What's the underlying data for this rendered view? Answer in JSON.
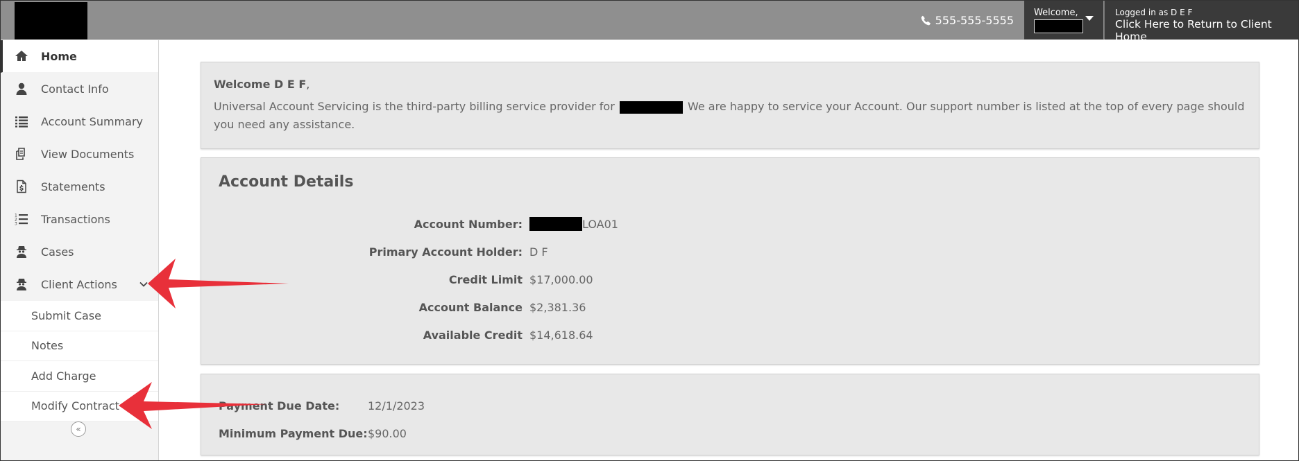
{
  "topbar": {
    "phone": "555-555-5555",
    "welcome_label": "Welcome,",
    "logged_in": "Logged in as D E F",
    "return_link": "Click Here to Return to Client Home"
  },
  "sidebar": {
    "items": [
      {
        "label": "Home",
        "icon": "home-icon"
      },
      {
        "label": "Contact Info",
        "icon": "user-icon"
      },
      {
        "label": "Account Summary",
        "icon": "list-icon"
      },
      {
        "label": "View Documents",
        "icon": "documents-icon"
      },
      {
        "label": "Statements",
        "icon": "statement-icon"
      },
      {
        "label": "Transactions",
        "icon": "ordered-list-icon"
      },
      {
        "label": "Cases",
        "icon": "agent-icon"
      },
      {
        "label": "Client Actions",
        "icon": "agent-icon"
      }
    ],
    "sub_items": [
      "Submit Case",
      "Notes",
      "Add Charge",
      "Modify Contract"
    ],
    "collapse_glyph": "«"
  },
  "welcome": {
    "greeting": "Welcome D E F",
    "comma": ",",
    "msg_before": "Universal Account Servicing is the third-party billing service provider for",
    "msg_after": "We are happy to service your Account. Our support number is listed at the top of every page should you need any assistance."
  },
  "details": {
    "title": "Account Details",
    "account_number_label": "Account Number:",
    "account_number_suffix": "LOA01",
    "holder_label": "Primary Account Holder:",
    "holder_value": "D F",
    "credit_limit_label": "Credit Limit",
    "credit_limit_value": "$17,000.00",
    "balance_label": "Account Balance",
    "balance_value": "$2,381.36",
    "available_label": "Available Credit",
    "available_value": "$14,618.64"
  },
  "payment": {
    "due_date_label": "Payment Due Date:",
    "due_date_value": "12/1/2023",
    "min_due_label": "Minimum Payment Due:",
    "min_due_value": "$90.00"
  },
  "colors": {
    "topbar": "#8f8f8f",
    "dark_box": "#3a3a3a",
    "panel": "#e8e8e8",
    "arrow": "#e8303a"
  }
}
